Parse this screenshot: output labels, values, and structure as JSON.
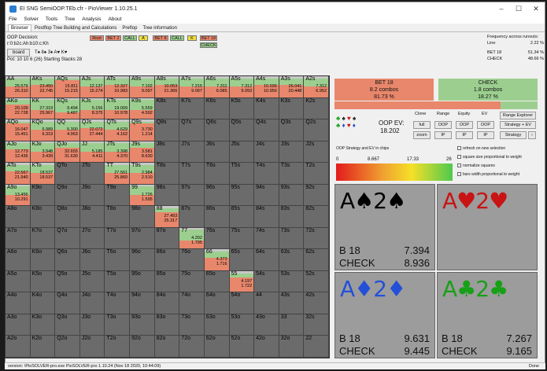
{
  "window": {
    "title": "EI SNG SemiOOP.TEb.cfr - PioViewer 1.10.25.1"
  },
  "menu": [
    "File",
    "Solver",
    "Tools",
    "Tree",
    "Analysis",
    "About"
  ],
  "tabs": [
    {
      "label": "Browser",
      "active": true
    },
    {
      "label": "Postflop Tree Building and Calculations",
      "active": false
    },
    {
      "label": "Preflop",
      "active": false
    },
    {
      "label": "Tree information",
      "active": false
    }
  ],
  "info": {
    "decision": "OOP Decision:",
    "board_line": "r:0:b2c:Ah:b10:c:Kh",
    "board_label": "board",
    "pot": "Pot: 10 10 6 (26) Starting Stacks 28"
  },
  "tree_buttons": {
    "row1": [
      "Root",
      "BET 2",
      "CALL",
      "A",
      "BET 8",
      "CALL",
      "K",
      "BET 18"
    ],
    "row2": [
      "CHECK"
    ]
  },
  "frequency": {
    "title": "Frequency across runouts:",
    "rows": [
      {
        "label": "Line",
        "value": "2.22 %"
      },
      {
        "label": "BET 18",
        "value": "51.34 %"
      },
      {
        "label": "CHECK",
        "value": "48.66 %"
      }
    ]
  },
  "grid": [
    [
      [
        "AA",
        "25.579",
        "26.310",
        0.5,
        0.4
      ],
      [
        "AKs",
        "23.450",
        "22.745",
        0.6,
        0.3
      ],
      [
        "AQs",
        "15.811",
        "15.215",
        0.8,
        0.1
      ],
      [
        "AJs",
        "12.137",
        "15.274",
        0.5,
        0.4
      ],
      [
        "ATs",
        "12.327",
        "10.983",
        0.6,
        0.3
      ],
      [
        "A9s",
        "7.102",
        "9.097",
        0.5,
        0.4
      ],
      [
        "A8s",
        "10.053",
        "21.366",
        0.6,
        0.3
      ],
      [
        "A7s",
        "7.215",
        "9.097",
        0.5,
        0.4
      ],
      [
        "A6s",
        "7.311",
        "6.085",
        0.5,
        0.4
      ],
      [
        "A5s",
        "7.312",
        "9.093",
        0.5,
        0.4
      ],
      [
        "A4s",
        "10.036",
        "10.956",
        0.6,
        0.3
      ],
      [
        "A3s",
        "26.041",
        "20.448",
        0.6,
        0.3
      ],
      [
        "A2s",
        "7.312",
        "6.952",
        0.5,
        0.4
      ]
    ],
    [
      [
        "AKo",
        "20.109",
        "22.728",
        0.7,
        0.2
      ],
      [
        "KK",
        "27.319",
        "25.967",
        0.4,
        0.5
      ],
      [
        "KQs",
        "9.494",
        "9.487",
        0.3,
        0.6
      ],
      [
        "KJs",
        "5.156",
        "8.375",
        0.4,
        0.5
      ],
      [
        "KTs",
        "19.009",
        "10.978",
        0.4,
        0.5
      ],
      [
        "K9s",
        "5.559",
        "4.592",
        0.4,
        0.5
      ],
      [
        "K8s",
        "",
        "",
        0,
        0
      ],
      [
        "K7s",
        "",
        "",
        0,
        0
      ],
      [
        "K6s",
        "",
        "",
        0,
        0
      ],
      [
        "K5s",
        "",
        "",
        0,
        0
      ],
      [
        "K4s",
        "",
        "",
        0,
        0
      ],
      [
        "K3s",
        "",
        "",
        0,
        0
      ],
      [
        "K2s",
        "",
        "",
        0,
        0
      ]
    ],
    [
      [
        "AQo",
        "16.047",
        "15.451",
        0.8,
        0.1
      ],
      [
        "KQo",
        "5.989",
        "6.319",
        0.5,
        0.4
      ],
      [
        "QQ",
        "5.300",
        "4.963",
        0.5,
        0.4
      ],
      [
        "QJs",
        "22.072",
        "27.444",
        0.6,
        0.3
      ],
      [
        "QTs",
        "4.629",
        "4.162",
        0.5,
        0.4
      ],
      [
        "Q9s",
        "3.730",
        "1.214",
        0.8,
        0.1
      ],
      [
        "Q8s",
        "",
        "",
        0,
        0
      ],
      [
        "Q7s",
        "",
        "",
        0,
        0
      ],
      [
        "Q6s",
        "",
        "",
        0,
        0
      ],
      [
        "Q5s",
        "",
        "",
        0,
        0
      ],
      [
        "Q4s",
        "",
        "",
        0,
        0
      ],
      [
        "Q3s",
        "",
        "",
        0,
        0
      ],
      [
        "Q2s",
        "",
        "",
        0,
        0
      ]
    ],
    [
      [
        "AJo",
        "12.773",
        "12.436",
        0.6,
        0.3
      ],
      [
        "KJo",
        "3.948",
        "3.439",
        0.5,
        0.4
      ],
      [
        "QJo",
        "32.655",
        "31.630",
        0.7,
        0.2
      ],
      [
        "JJ",
        "5.185",
        "4.411",
        0.5,
        0.4
      ],
      [
        "JTs",
        "3.398",
        "4.370",
        0.5,
        0.4
      ],
      [
        "J9s",
        "3.581",
        "8.630",
        0.7,
        0.2
      ],
      [
        "J8s",
        "",
        "",
        0,
        0
      ],
      [
        "J7s",
        "",
        "",
        0,
        0
      ],
      [
        "J6s",
        "",
        "",
        0,
        0
      ],
      [
        "J5s",
        "",
        "",
        0,
        0
      ],
      [
        "J4s",
        "",
        "",
        0,
        0
      ],
      [
        "J3s",
        "",
        "",
        0,
        0
      ],
      [
        "J2s",
        "",
        "",
        0,
        0
      ]
    ],
    [
      [
        "ATo",
        "22.567",
        "21.940",
        0.6,
        0.3
      ],
      [
        "KTo",
        "18.537",
        "18.537",
        0.5,
        0.4
      ],
      [
        "QTo",
        "",
        "",
        0,
        0
      ],
      [
        "JTo",
        "",
        "",
        0,
        0
      ],
      [
        "TT",
        "27.561",
        "25.860",
        0.5,
        0.4
      ],
      [
        "T9s",
        "2.984",
        "2.510",
        0.5,
        0.4
      ],
      [
        "T8s",
        "",
        "",
        0,
        0
      ],
      [
        "T7s",
        "",
        "",
        0,
        0
      ],
      [
        "T6s",
        "",
        "",
        0,
        0
      ],
      [
        "T5s",
        "",
        "",
        0,
        0
      ],
      [
        "T4s",
        "",
        "",
        0,
        0
      ],
      [
        "T3s",
        "",
        "",
        0,
        0
      ],
      [
        "T2s",
        "",
        "",
        0,
        0
      ]
    ],
    [
      [
        "A9o",
        "13.456",
        "10.291",
        0.5,
        0.4
      ],
      [
        "K9o",
        "",
        "",
        0,
        0
      ],
      [
        "Q9o",
        "",
        "",
        0,
        0
      ],
      [
        "J9o",
        "",
        "",
        0,
        0
      ],
      [
        "T9o",
        "",
        "",
        0,
        0
      ],
      [
        "99",
        "1.726",
        "1.595",
        0.5,
        0.4
      ],
      [
        "98s",
        "",
        "",
        0,
        0
      ],
      [
        "97s",
        "",
        "",
        0,
        0
      ],
      [
        "96s",
        "",
        "",
        0,
        0
      ],
      [
        "95s",
        "",
        "",
        0,
        0
      ],
      [
        "94s",
        "",
        "",
        0,
        0
      ],
      [
        "93s",
        "",
        "",
        0,
        0
      ],
      [
        "92s",
        "",
        "",
        0,
        0
      ]
    ],
    [
      [
        "A8o",
        "",
        "",
        0,
        0
      ],
      [
        "K8o",
        "",
        "",
        0,
        0
      ],
      [
        "Q8o",
        "",
        "",
        0,
        0
      ],
      [
        "J8o",
        "",
        "",
        0,
        0
      ],
      [
        "T8o",
        "",
        "",
        0,
        0
      ],
      [
        "98o",
        "",
        "",
        0,
        0
      ],
      [
        "88",
        "27.493",
        "25.317",
        0.7,
        0.2
      ],
      [
        "87s",
        "",
        "",
        0,
        0
      ],
      [
        "86s",
        "",
        "",
        0,
        0
      ],
      [
        "85s",
        "",
        "",
        0,
        0
      ],
      [
        "84s",
        "",
        "",
        0,
        0
      ],
      [
        "83s",
        "",
        "",
        0,
        0
      ],
      [
        "82s",
        "",
        "",
        0,
        0
      ]
    ],
    [
      [
        "A7o",
        "",
        "",
        0,
        0
      ],
      [
        "K7o",
        "",
        "",
        0,
        0
      ],
      [
        "Q7o",
        "",
        "",
        0,
        0
      ],
      [
        "J7o",
        "",
        "",
        0,
        0
      ],
      [
        "T7o",
        "",
        "",
        0,
        0
      ],
      [
        "97o",
        "",
        "",
        0,
        0
      ],
      [
        "87o",
        "",
        "",
        0,
        0
      ],
      [
        "77",
        "4.202",
        "1.795",
        0.4,
        0.5
      ],
      [
        "76s",
        "",
        "",
        0,
        0
      ],
      [
        "75s",
        "",
        "",
        0,
        0
      ],
      [
        "74s",
        "",
        "",
        0,
        0
      ],
      [
        "73s",
        "",
        "",
        0,
        0
      ],
      [
        "72s",
        "",
        "",
        0,
        0
      ]
    ],
    [
      [
        "A6o",
        "",
        "",
        0,
        0
      ],
      [
        "K6o",
        "",
        "",
        0,
        0
      ],
      [
        "Q6o",
        "",
        "",
        0,
        0
      ],
      [
        "J6o",
        "",
        "",
        0,
        0
      ],
      [
        "T6o",
        "",
        "",
        0,
        0
      ],
      [
        "96o",
        "",
        "",
        0,
        0
      ],
      [
        "86o",
        "",
        "",
        0,
        0
      ],
      [
        "76o",
        "",
        "",
        0,
        0
      ],
      [
        "66",
        "4.373",
        "1.716",
        0.6,
        0.3
      ],
      [
        "65s",
        "",
        "",
        0,
        0
      ],
      [
        "64s",
        "",
        "",
        0,
        0
      ],
      [
        "63s",
        "",
        "",
        0,
        0
      ],
      [
        "62s",
        "",
        "",
        0,
        0
      ]
    ],
    [
      [
        "A5o",
        "",
        "",
        0,
        0
      ],
      [
        "K5o",
        "",
        "",
        0,
        0
      ],
      [
        "Q5o",
        "",
        "",
        0,
        0
      ],
      [
        "J5o",
        "",
        "",
        0,
        0
      ],
      [
        "T5o",
        "",
        "",
        0,
        0
      ],
      [
        "95o",
        "",
        "",
        0,
        0
      ],
      [
        "85o",
        "",
        "",
        0,
        0
      ],
      [
        "75o",
        "",
        "",
        0,
        0
      ],
      [
        "65o",
        "",
        "",
        0,
        0
      ],
      [
        "55",
        "4.197",
        "1.722",
        0.7,
        0.2
      ],
      [
        "54s",
        "",
        "",
        0,
        0
      ],
      [
        "53s",
        "",
        "",
        0,
        0
      ],
      [
        "52s",
        "",
        "",
        0,
        0
      ]
    ],
    [
      [
        "A4o",
        "",
        "",
        0,
        0
      ],
      [
        "K4o",
        "",
        "",
        0,
        0
      ],
      [
        "Q4o",
        "",
        "",
        0,
        0
      ],
      [
        "J4o",
        "",
        "",
        0,
        0
      ],
      [
        "T4o",
        "",
        "",
        0,
        0
      ],
      [
        "94o",
        "",
        "",
        0,
        0
      ],
      [
        "84o",
        "",
        "",
        0,
        0
      ],
      [
        "74o",
        "",
        "",
        0,
        0
      ],
      [
        "64o",
        "",
        "",
        0,
        0
      ],
      [
        "54o",
        "",
        "",
        0,
        0
      ],
      [
        "44",
        "",
        "",
        0,
        0
      ],
      [
        "43s",
        "",
        "",
        0,
        0
      ],
      [
        "42s",
        "",
        "",
        0,
        0
      ]
    ],
    [
      [
        "A3o",
        "",
        "",
        0,
        0
      ],
      [
        "K3o",
        "",
        "",
        0,
        0
      ],
      [
        "Q3o",
        "",
        "",
        0,
        0
      ],
      [
        "J3o",
        "",
        "",
        0,
        0
      ],
      [
        "T3o",
        "",
        "",
        0,
        0
      ],
      [
        "93o",
        "",
        "",
        0,
        0
      ],
      [
        "83o",
        "",
        "",
        0,
        0
      ],
      [
        "73o",
        "",
        "",
        0,
        0
      ],
      [
        "63o",
        "",
        "",
        0,
        0
      ],
      [
        "53o",
        "",
        "",
        0,
        0
      ],
      [
        "43o",
        "",
        "",
        0,
        0
      ],
      [
        "33",
        "",
        "",
        0,
        0
      ],
      [
        "32s",
        "",
        "",
        0,
        0
      ]
    ],
    [
      [
        "A2o",
        "",
        "",
        0,
        0
      ],
      [
        "K2o",
        "",
        "",
        0,
        0
      ],
      [
        "Q2o",
        "",
        "",
        0,
        0
      ],
      [
        "J2o",
        "",
        "",
        0,
        0
      ],
      [
        "T2o",
        "",
        "",
        0,
        0
      ],
      [
        "92o",
        "",
        "",
        0,
        0
      ],
      [
        "82o",
        "",
        "",
        0,
        0
      ],
      [
        "72o",
        "",
        "",
        0,
        0
      ],
      [
        "62o",
        "",
        "",
        0,
        0
      ],
      [
        "52o",
        "",
        "",
        0,
        0
      ],
      [
        "42o",
        "",
        "",
        0,
        0
      ],
      [
        "32o",
        "",
        "",
        0,
        0
      ],
      [
        "22",
        "",
        "",
        0,
        0
      ]
    ]
  ],
  "actions": {
    "bet": {
      "label": "BET 18",
      "combos": "8.2 combos",
      "pct": "81.73 %",
      "ratio": 0.8173,
      "color": "#e8876c"
    },
    "check": {
      "label": "CHECK",
      "combos": "1.8 combos",
      "pct": "18.27 %",
      "ratio": 0.1827,
      "color": "#9ccf8f"
    }
  },
  "controls": {
    "headers": [
      "Clone",
      "Range",
      "Equity",
      "EV"
    ],
    "oop_ev_label": "OOP EV:",
    "oop_ev_value": "18.202",
    "buttons_row1": [
      "full",
      "OOP",
      "OOP",
      "OOP"
    ],
    "buttons_row2": [
      "zoom",
      "IP",
      "IP",
      "IP"
    ],
    "range_explorer": "Range Explorer",
    "strategy_ev": "Strategy + EV",
    "strategy": "Strategy",
    "strat_label": "OOP Strategy and EV in chips",
    "checkboxes": [
      "refresh on new selection",
      "square size proportional to weight",
      "normalize squares",
      "bars width proportional to weight"
    ],
    "scale": [
      "0",
      "8.667",
      "17.33",
      "26"
    ]
  },
  "combos": [
    {
      "cards": "A♠2♠",
      "color": "#000000",
      "bet": "7.394",
      "check": "8.936"
    },
    {
      "cards": "A♥2♥",
      "color": "#c81414",
      "bet": "",
      "check": ""
    },
    {
      "cards": "A♦2♦",
      "color": "#2450d8",
      "bet": "9.631",
      "check": "9.445"
    },
    {
      "cards": "A♣2♣",
      "color": "#18a018",
      "bet": "7.267",
      "check": "9.165"
    }
  ],
  "combo_labels": {
    "bet": "B 18",
    "check": "CHECK"
  },
  "status": {
    "left": "version: \\PioSOLVER-pro.exe PioSOLVER-pro 1.10.24 (Nov 18 2020, 10:44:09)",
    "right": "Done"
  }
}
